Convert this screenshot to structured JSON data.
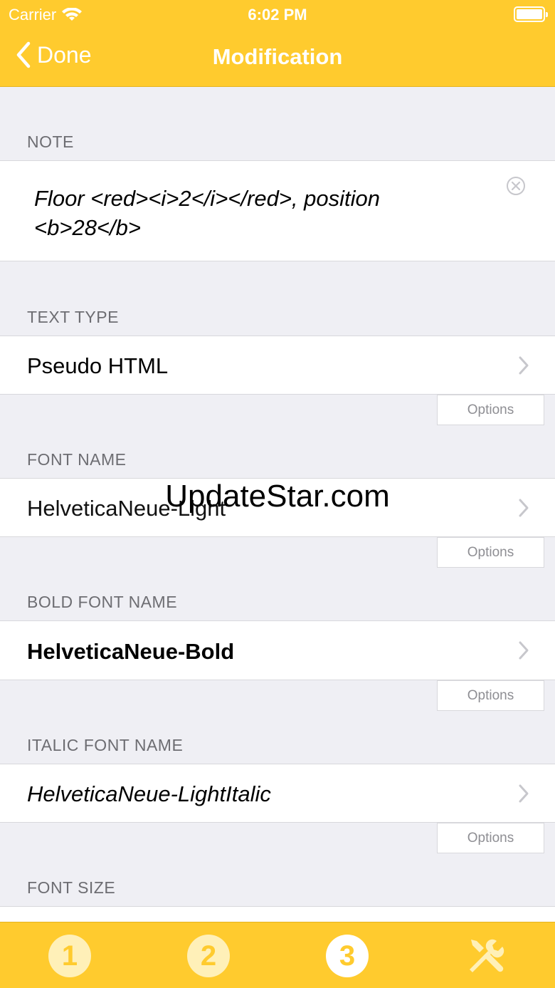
{
  "status_bar": {
    "carrier": "Carrier",
    "time": "6:02 PM"
  },
  "nav": {
    "back_label": "Done",
    "title": "Modification"
  },
  "sections": {
    "note": {
      "header": "NOTE",
      "value": "Floor <red><i>2</i></red>, position <b>28</b>"
    },
    "text_type": {
      "header": "TEXT TYPE",
      "value": "Pseudo HTML",
      "options_label": "Options"
    },
    "font_name": {
      "header": "FONT NAME",
      "value": "HelveticaNeue-Light",
      "options_label": "Options"
    },
    "bold_font_name": {
      "header": "BOLD FONT NAME",
      "value": "HelveticaNeue-Bold",
      "options_label": "Options"
    },
    "italic_font_name": {
      "header": "ITALIC FONT NAME",
      "value": "HelveticaNeue-LightItalic",
      "options_label": "Options"
    },
    "font_size": {
      "header": "FONT SIZE"
    }
  },
  "watermark": "UpdateStar.com",
  "tabbar": {
    "tabs": [
      {
        "label": "1",
        "icon": "number-1-icon",
        "selected": false
      },
      {
        "label": "2",
        "icon": "number-2-icon",
        "selected": false
      },
      {
        "label": "3",
        "icon": "number-3-icon",
        "selected": true
      },
      {
        "icon": "tools-icon",
        "selected": false
      }
    ]
  },
  "colors": {
    "accent": "#ffcb2e",
    "background": "#efeff4",
    "header_text": "#6d6d72",
    "inactive_tab": "#fff0b8"
  }
}
